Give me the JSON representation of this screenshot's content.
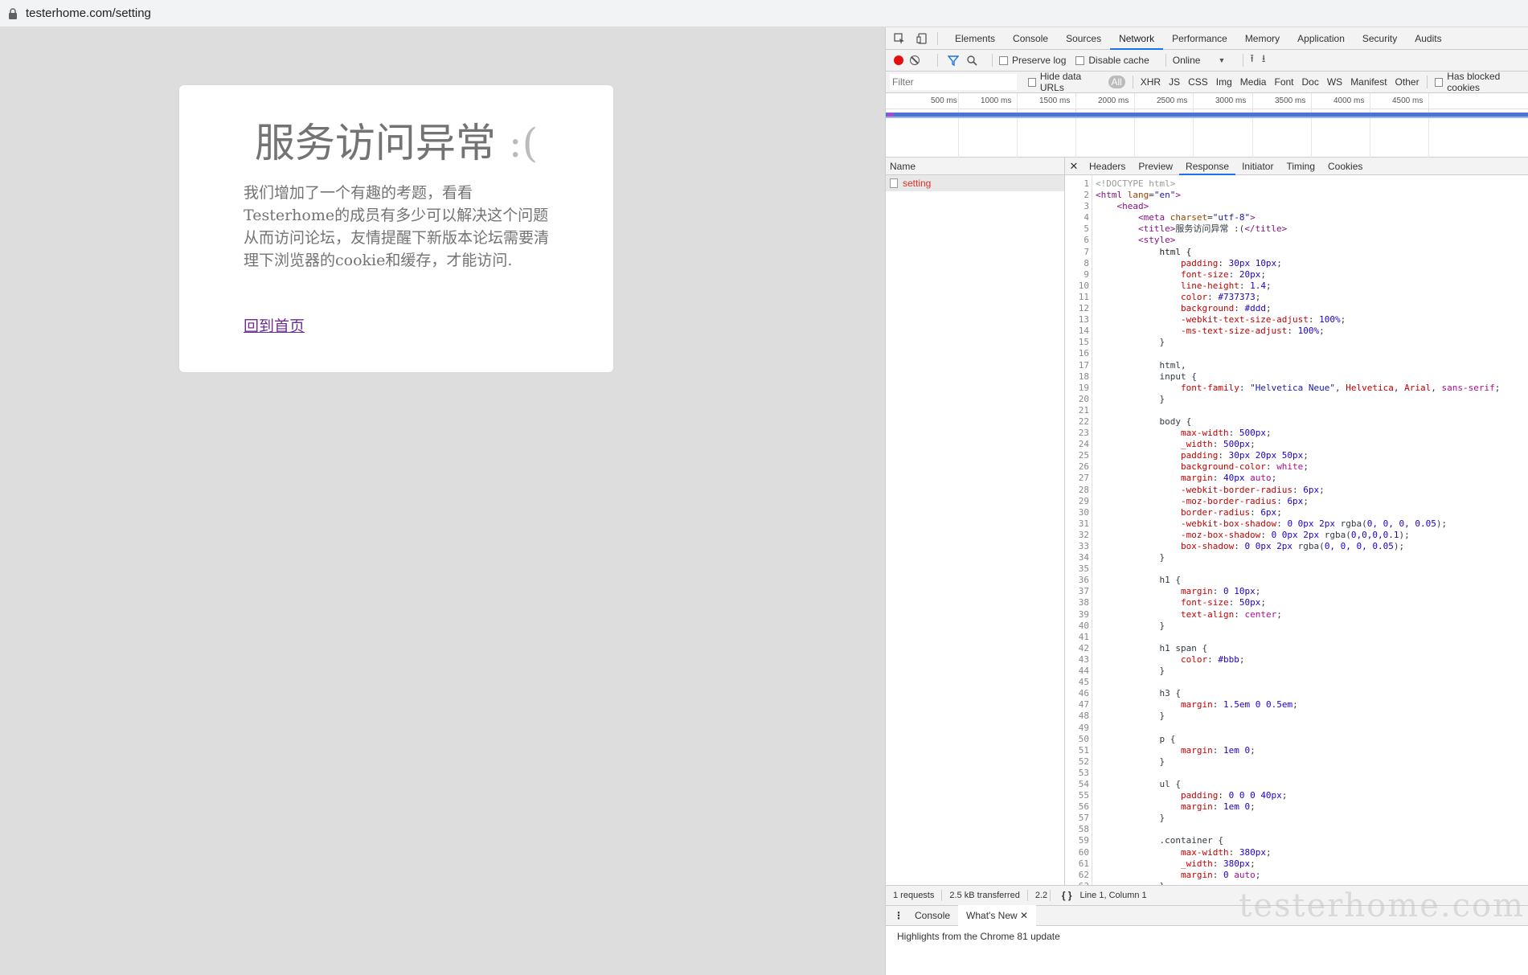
{
  "browser": {
    "url": "testerhome.com/setting"
  },
  "page": {
    "title": "服务访问异常",
    "sad_face": ":(",
    "message": "我们增加了一个有趣的考题，看看Testerhome的成员有多少可以解决这个问题从而访问论坛，友情提醒下新版本论坛需要清理下浏览器的cookie和缓存，才能访问.",
    "home_link": "回到首页"
  },
  "devtools": {
    "tabs": [
      "Elements",
      "Console",
      "Sources",
      "Network",
      "Performance",
      "Memory",
      "Application",
      "Security",
      "Audits"
    ],
    "active_tab": "Network",
    "toolbar": {
      "preserve_log": "Preserve log",
      "disable_cache": "Disable cache",
      "throttle": "Online"
    },
    "filter": {
      "placeholder": "Filter",
      "hide_data_urls": "Hide data URLs",
      "types": [
        "All",
        "XHR",
        "JS",
        "CSS",
        "Img",
        "Media",
        "Font",
        "Doc",
        "WS",
        "Manifest",
        "Other"
      ],
      "has_blocked": "Has blocked cookies"
    },
    "overview_ticks": [
      "500 ms",
      "1000 ms",
      "1500 ms",
      "2000 ms",
      "2500 ms",
      "3000 ms",
      "3500 ms",
      "4000 ms",
      "4500 ms"
    ],
    "name_header": "Name",
    "requests": [
      "setting"
    ],
    "detail_tabs": [
      "Headers",
      "Preview",
      "Response",
      "Initiator",
      "Timing",
      "Cookies"
    ],
    "active_detail_tab": "Response",
    "status": {
      "requests": "1 requests",
      "transferred": "2.5 kB transferred",
      "extra": "2.2 k",
      "position": "Line 1, Column 1"
    },
    "drawer": {
      "tabs": [
        "Console",
        "What's New"
      ],
      "active": "What's New",
      "body": "Highlights from the Chrome 81 update"
    },
    "watermark": "testerhome.com"
  }
}
